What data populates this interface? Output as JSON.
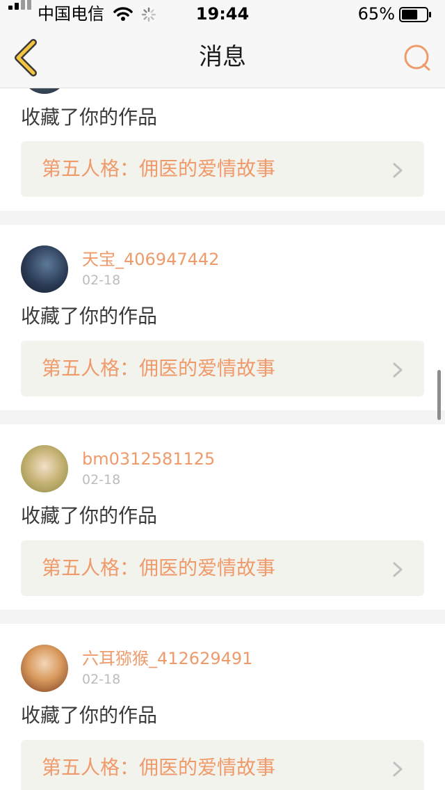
{
  "status_bar": {
    "carrier": "中国电信",
    "time": "19:44",
    "battery": "65%",
    "battery_level": 0.65
  },
  "nav": {
    "title": "消息",
    "back_icon": "chevron-left-icon",
    "search_icon": "search-icon"
  },
  "colors": {
    "accent": "#ef9a6a",
    "back_chevron": "#f5c542",
    "card_link_bg": "#f3f3ee"
  },
  "notifications": [
    {
      "action": "收藏了你的作品",
      "work_title": "第五人格：佣医的爱情故事"
    },
    {
      "username": "天宝_406947442",
      "date": "02-18",
      "action": "收藏了你的作品",
      "work_title": "第五人格：佣医的爱情故事"
    },
    {
      "username": "bm0312581125",
      "date": "02-18",
      "action": "收藏了你的作品",
      "work_title": "第五人格：佣医的爱情故事"
    },
    {
      "username": "六耳猕猴_412629491",
      "date": "02-18",
      "action": "收藏了你的作品",
      "work_title": "第五人格：佣医的爱情故事"
    }
  ]
}
